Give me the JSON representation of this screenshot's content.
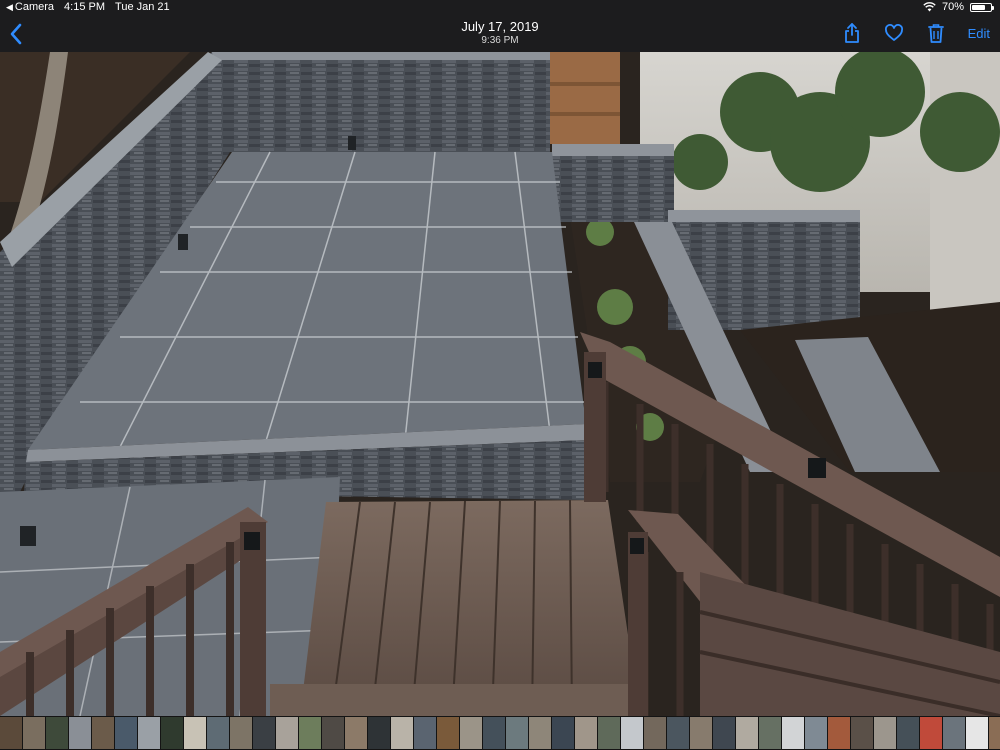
{
  "status": {
    "app_back": "Camera",
    "time": "4:15 PM",
    "date": "Tue Jan 21",
    "battery": "70%",
    "battery_level": 0.7
  },
  "nav": {
    "title": "July 17, 2019",
    "subtitle": "9:36 PM",
    "edit_label": "Edit"
  },
  "icons": {
    "back": "chevron-left-icon",
    "share": "share-icon",
    "favorite": "heart-icon",
    "trash": "trash-icon",
    "wifi": "wifi-icon"
  },
  "colors": {
    "accent": "#2f8cff"
  },
  "filmstrip": [
    "#5b4a3a",
    "#7a6e5f",
    "#3e4a3a",
    "#8a8f96",
    "#6b5b4a",
    "#4a5a6a",
    "#9aa0a6",
    "#2f3a2e",
    "#c8c2b5",
    "#5e6b74",
    "#7d7466",
    "#3a3f44",
    "#a8a29a",
    "#6d7d5c",
    "#4f4a45",
    "#8c7a68",
    "#2e3336",
    "#b9b3a8",
    "#5a6470",
    "#7a5a3a",
    "#9b9488",
    "#44505a",
    "#6c7a7e",
    "#8e8679",
    "#3b4652",
    "#a0968a",
    "#5f6a5a",
    "#c4c8cc",
    "#73685c",
    "#4b565f",
    "#877b6d",
    "#3f4750",
    "#b0aaa0",
    "#667063",
    "#d2d4d6",
    "#7f8a94",
    "#a35a3c",
    "#5a5048",
    "#9c968d",
    "#455058",
    "#c04a3a",
    "#6b747c",
    "#e6e6e6",
    "#8a6d55",
    "#f2f2f2",
    "#52606a",
    "#ffffff",
    "#d84a3c",
    "#f4f4f4",
    "#3a3a3a"
  ]
}
